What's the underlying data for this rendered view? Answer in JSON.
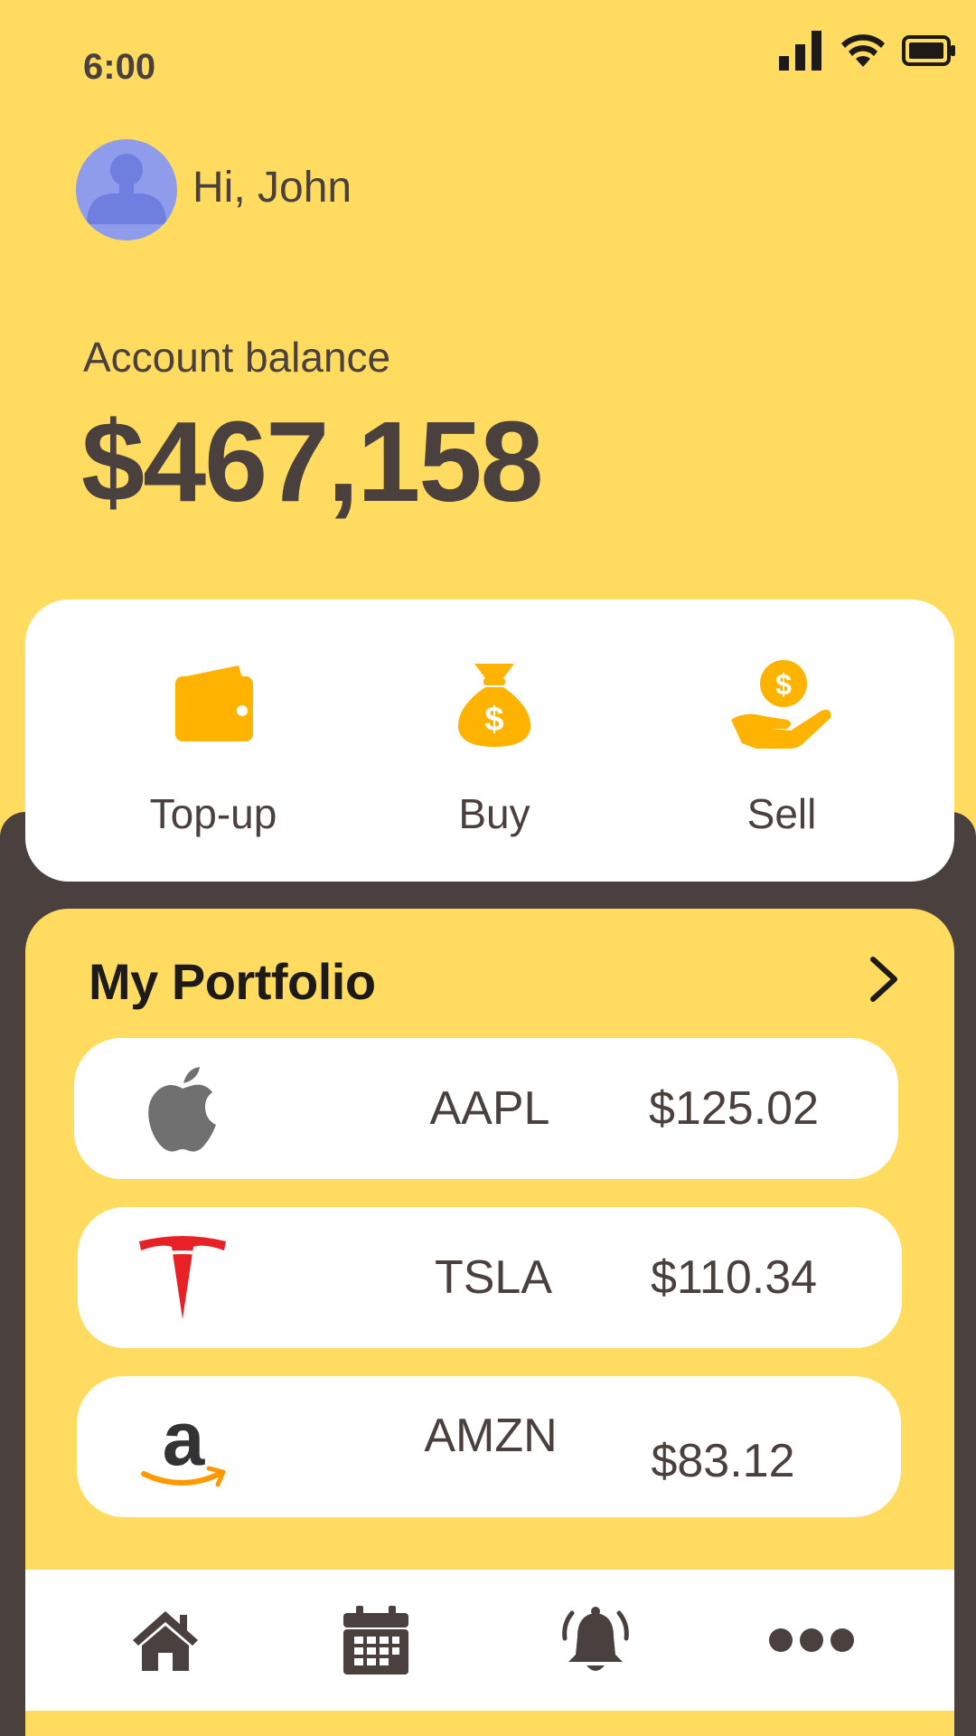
{
  "status_bar": {
    "time": "6:00"
  },
  "header": {
    "greeting": "Hi, John"
  },
  "balance": {
    "label": "Account balance",
    "value": "$467,158"
  },
  "actions": [
    {
      "label": "Top-up",
      "icon": "wallet-icon"
    },
    {
      "label": "Buy",
      "icon": "money-bag-icon"
    },
    {
      "label": "Sell",
      "icon": "hand-coin-icon"
    }
  ],
  "portfolio": {
    "title": "My Portfolio",
    "stocks": [
      {
        "ticker": "AAPL",
        "price": "$125.02",
        "icon": "apple-logo"
      },
      {
        "ticker": "TSLA",
        "price": "$110.34",
        "icon": "tesla-logo"
      },
      {
        "ticker": "AMZN",
        "price": "$83.12",
        "icon": "amazon-logo"
      }
    ]
  },
  "nav": [
    "home-icon",
    "calendar-icon",
    "bell-icon",
    "more-icon"
  ],
  "colors": {
    "background": "#FFDC5F",
    "dark": "#4A403D",
    "accent": "#FDB300",
    "tesla": "#E82127",
    "amazon_arrow": "#FF9900"
  }
}
